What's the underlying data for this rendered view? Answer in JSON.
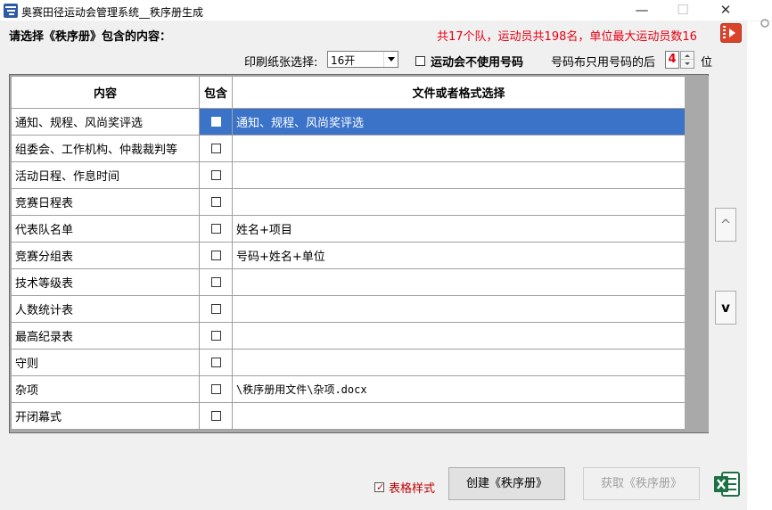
{
  "window": {
    "title": "奥赛田径运动会管理系统__秩序册生成",
    "minimize": "—",
    "maximize": "☐",
    "close": "✕"
  },
  "header": {
    "heading": "请选择《秩序册》包含的内容：",
    "stats": "共17个队，运动员共198名，单位最大运动员数16",
    "video_icon": "video-play-icon"
  },
  "options": {
    "paper_label": "印刷纸张选择:",
    "paper_value": "16开",
    "no_number_label": "运动会不使用号码",
    "no_number_checked": false,
    "digits_label": "号码布只用号码的后",
    "digits_value": "4",
    "digits_unit": "位"
  },
  "grid": {
    "headers": [
      "内容",
      "包含",
      "文件或者格式选择"
    ],
    "rows": [
      {
        "name": "通知、规程、风尚奖评选",
        "included": false,
        "file": "通知、规程、风尚奖评选",
        "selected": true,
        "mono": false
      },
      {
        "name": "组委会、工作机构、仲裁裁判等",
        "included": false,
        "file": "",
        "selected": false,
        "mono": false
      },
      {
        "name": "活动日程、作息时间",
        "included": false,
        "file": "",
        "selected": false,
        "mono": false
      },
      {
        "name": "竞赛日程表",
        "included": false,
        "file": "",
        "selected": false,
        "mono": false
      },
      {
        "name": "代表队名单",
        "included": false,
        "file": "姓名+项目",
        "selected": false,
        "mono": false
      },
      {
        "name": "竞赛分组表",
        "included": false,
        "file": "号码+姓名+单位",
        "selected": false,
        "mono": false
      },
      {
        "name": "技术等级表",
        "included": false,
        "file": "",
        "selected": false,
        "mono": false
      },
      {
        "name": "人数统计表",
        "included": false,
        "file": "",
        "selected": false,
        "mono": false
      },
      {
        "name": "最高纪录表",
        "included": false,
        "file": "",
        "selected": false,
        "mono": false
      },
      {
        "name": "守则",
        "included": false,
        "file": "",
        "selected": false,
        "mono": false
      },
      {
        "name": "杂项",
        "included": false,
        "file": "\\秩序册用文件\\杂项.docx",
        "selected": false,
        "mono": true
      },
      {
        "name": "开闭幕式",
        "included": false,
        "file": "",
        "selected": false,
        "mono": false
      }
    ]
  },
  "nav": {
    "up": "^",
    "down": "v"
  },
  "footer": {
    "table_style_label": "表格样式",
    "table_style_checked": true,
    "create_button": "创建《秩序册》",
    "get_button": "获取《秩序册》",
    "excel_icon": "excel-icon"
  },
  "colors": {
    "accent_red": "#e60012",
    "selection_blue": "#3b73c9",
    "excel_green": "#1d7044"
  }
}
